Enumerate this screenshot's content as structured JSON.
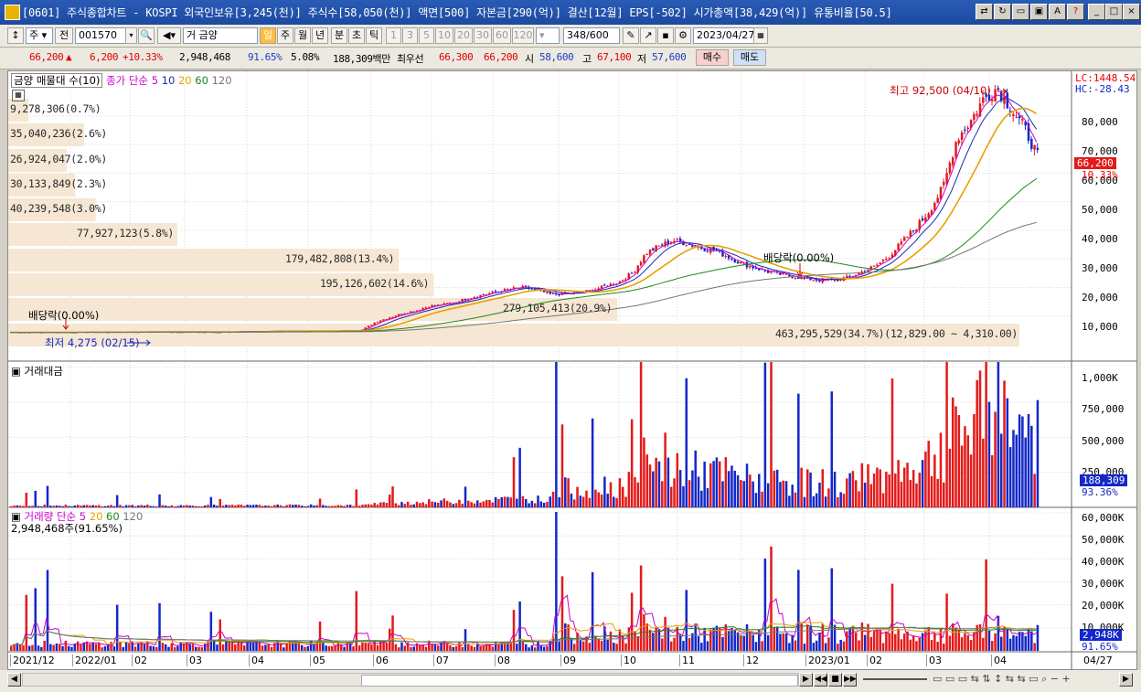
{
  "window": {
    "title": "[0601] 주식종합차트 - KOSPI 외국인보유[3,245(천)] 주식수[58,050(천)] 액면[500] 자본금[290(억)] 결산[12월] EPS[-502] 시가총액[38,429(억)] 유통비율[50.5]"
  },
  "toolbar": {
    "market_select": "주",
    "prev_label": "전",
    "code_value": "001570",
    "name_value": "금양",
    "name_prefix": "거",
    "period_buttons": [
      "일",
      "주",
      "월",
      "년",
      "분",
      "초",
      "틱"
    ],
    "minute_buttons": [
      "1",
      "3",
      "5",
      "10",
      "20",
      "30",
      "60",
      "120"
    ],
    "count_current": "348",
    "count_total": "/600",
    "date_value": "2023/04/27"
  },
  "quote": {
    "price": "66,200",
    "change": "6,200",
    "change_pct": "+10.33%",
    "volume": "2,948,468",
    "vol_ratio": "91.65%",
    "turnover": "5.08%",
    "amount": "188,309백만",
    "pref_label": "최우선",
    "ask": "66,300",
    "bid": "66,200",
    "open_label": "시",
    "open": "58,600",
    "high_label": "고",
    "high": "67,100",
    "low_label": "저",
    "low": "57,600",
    "buy_label": "매수",
    "sell_label": "매도"
  },
  "colors": {
    "up": "#e41a1a",
    "down": "#1428c8",
    "ma5": "#cc00cc",
    "ma10": "#1a2ab0",
    "ma20": "#e8a100",
    "ma60": "#1a8a1a",
    "ma120": "#777777",
    "volume_profile": "#f5e7d3"
  },
  "price_panel": {
    "legend": {
      "vp_label": "금양 매물대 수(10)",
      "ma_label": "종가 단순",
      "periods": [
        "5",
        "10",
        "20",
        "60",
        "120"
      ]
    },
    "corner_right_top": "LC:1448.54",
    "corner_right_2": "HC:-28.43",
    "current_price_badge": "66,200",
    "current_pct_badge": "10.33%",
    "y_ticks": [
      "80,000",
      "70,000",
      "60,000",
      "50,000",
      "40,000",
      "30,000",
      "20,000",
      "10,000"
    ],
    "annotations": {
      "high": "최고 92,500 (04/10)",
      "low": "최저 4,275 (02/15)",
      "ex_div_1": "배당락(0.00%)",
      "ex_div_2": "배당락(0.00%)"
    },
    "volume_profile": [
      {
        "label": "9,278,306(0.7%)",
        "share": 0.7
      },
      {
        "label": "35,040,236(2.6%)",
        "share": 2.6
      },
      {
        "label": "26,924,047(2.0%)",
        "share": 2.0
      },
      {
        "label": "30,133,849(2.3%)",
        "share": 2.3
      },
      {
        "label": "40,239,548(3.0%)",
        "share": 3.0
      },
      {
        "label": "77,927,123(5.8%)",
        "share": 5.8
      },
      {
        "label": "179,482,808(13.4%)",
        "share": 13.4
      },
      {
        "label": "195,126,602(14.6%)",
        "share": 14.6
      },
      {
        "label": "279,105,413(20.9%)",
        "share": 20.9
      },
      {
        "label": "463,295,529(34.7%)(12,829.00 ~ 4,310.00)",
        "share": 34.7
      }
    ]
  },
  "amount_panel": {
    "title": "거래대금",
    "y_ticks": [
      "1,000K",
      "750,000",
      "500,000",
      "250,000"
    ],
    "current_badge": "188,309",
    "current_pct": "93.36%"
  },
  "volume_panel": {
    "legend_label": "거래량",
    "ma_label": "단순",
    "periods": [
      "5",
      "20",
      "60",
      "120"
    ],
    "current_text": "2,948,468주(91.65%)",
    "y_ticks": [
      "60,000K",
      "50,000K",
      "40,000K",
      "30,000K",
      "20,000K",
      "10,000K"
    ],
    "current_badge": "2,948K",
    "current_pct": "91.65%"
  },
  "x_axis": {
    "labels": [
      "2021/12",
      "2022/01",
      "02",
      "03",
      "04",
      "05",
      "06",
      "07",
      "08",
      "09",
      "10",
      "11",
      "12",
      "2023/01",
      "02",
      "03",
      "04"
    ],
    "end_label": "04/27"
  },
  "chart_data": {
    "type": "candlestick",
    "title": "금양 (001570)",
    "price_series_close": [
      4300,
      4300,
      4310,
      4320,
      4330,
      4350,
      4360,
      4400,
      4420,
      4450,
      4500,
      4480,
      4460,
      4420,
      4400,
      4380,
      4450,
      4500,
      4600,
      4700,
      4750,
      4800,
      4760,
      4780,
      4800,
      4850,
      5200,
      8000,
      9500,
      11000,
      12000,
      13500,
      14000,
      15000,
      16500,
      17500,
      18500,
      19500,
      20000,
      19000,
      17500,
      17800,
      18200,
      19000,
      20500,
      22000,
      25000,
      32000,
      34500,
      36500,
      35500,
      34000,
      33000,
      31000,
      28500,
      27000,
      25500,
      24500,
      23800,
      23000,
      22500,
      22800,
      23500,
      25500,
      27500,
      31000,
      36000,
      41000,
      47000,
      55000,
      72000,
      78000,
      86000,
      90000,
      83000,
      76000,
      66200
    ],
    "price_ylim": [
      0,
      95000
    ],
    "amount_unit": "백만원",
    "amount_ylim": [
      0,
      1050000
    ],
    "volume_unit": "천주",
    "volume_ylim": [
      0,
      62000
    ],
    "grid": true
  }
}
